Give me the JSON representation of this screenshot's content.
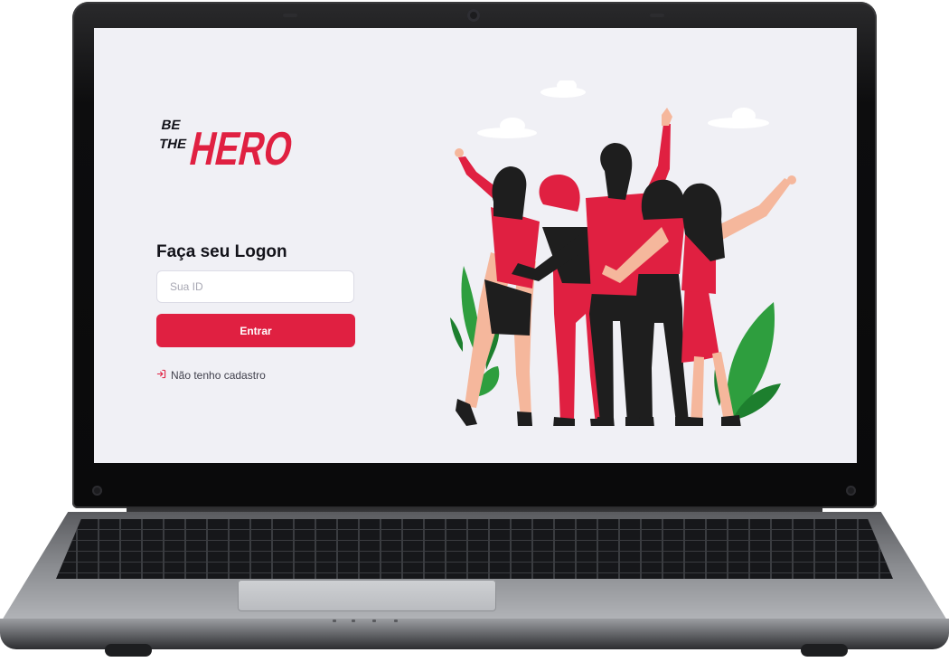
{
  "brand": {
    "name_line1": "BE",
    "name_line2": "THE",
    "name_line3": "HERO"
  },
  "logon": {
    "title": "Faça seu Logon",
    "id_input": {
      "placeholder": "Sua ID",
      "value": ""
    },
    "enter_button_label": "Entrar",
    "register_link_label": "Não tenho cadastro",
    "register_icon": "log-in-icon"
  },
  "colors": {
    "accent": "#E02041",
    "background": "#F0F0F5",
    "title": "#13131A",
    "link_text": "#41414D",
    "placeholder": "#A8A8B3"
  }
}
